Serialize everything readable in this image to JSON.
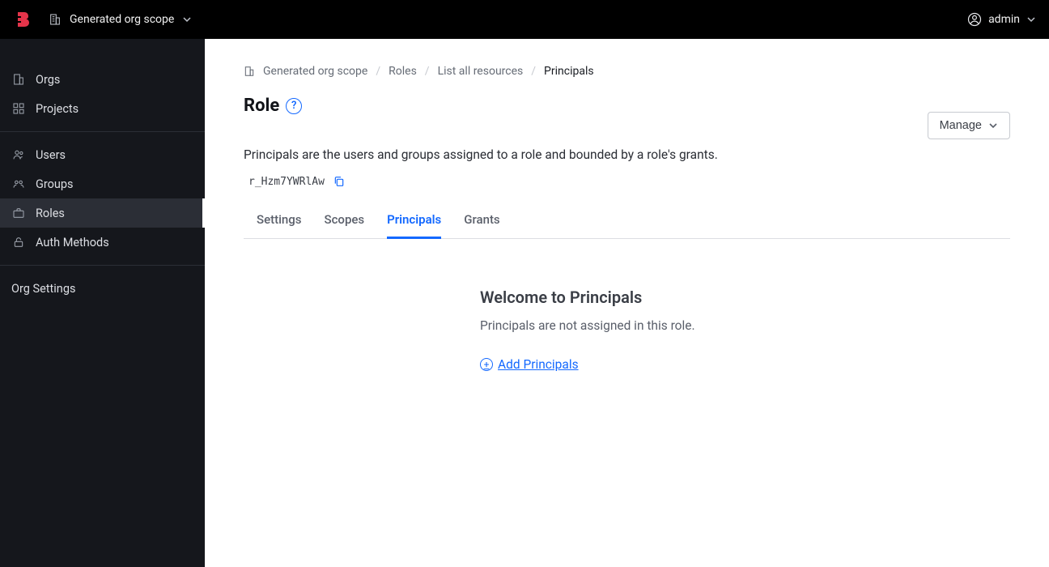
{
  "header": {
    "scope_label": "Generated org scope",
    "user_label": "admin"
  },
  "sidebar": {
    "groups": [
      {
        "items": [
          {
            "id": "orgs",
            "label": "Orgs",
            "icon": "building-icon"
          },
          {
            "id": "projects",
            "label": "Projects",
            "icon": "grid-icon"
          }
        ]
      },
      {
        "items": [
          {
            "id": "users",
            "label": "Users",
            "icon": "users-icon"
          },
          {
            "id": "groups",
            "label": "Groups",
            "icon": "group-icon"
          },
          {
            "id": "roles",
            "label": "Roles",
            "icon": "briefcase-icon",
            "active": true
          },
          {
            "id": "auth-methods",
            "label": "Auth Methods",
            "icon": "lock-icon"
          }
        ]
      }
    ],
    "settings_label": "Org Settings"
  },
  "breadcrumb": {
    "items": [
      {
        "label": "Generated org scope"
      },
      {
        "label": "Roles"
      },
      {
        "label": "List all resources"
      },
      {
        "label": "Principals",
        "current": true
      }
    ]
  },
  "page": {
    "title": "Role",
    "description": "Principals are the users and groups assigned to a role and bounded by a role's grants.",
    "role_id": "r_Hzm7YWRlAw",
    "manage_label": "Manage"
  },
  "tabs": [
    {
      "id": "settings",
      "label": "Settings"
    },
    {
      "id": "scopes",
      "label": "Scopes"
    },
    {
      "id": "principals",
      "label": "Principals",
      "active": true
    },
    {
      "id": "grants",
      "label": "Grants"
    }
  ],
  "empty": {
    "title": "Welcome to Principals",
    "description": "Principals are not assigned in this role.",
    "add_label": "Add Principals"
  }
}
